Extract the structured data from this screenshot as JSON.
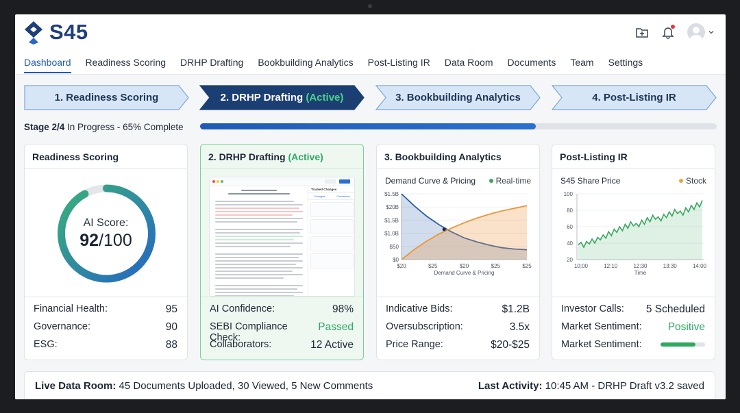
{
  "app": {
    "name": "S45"
  },
  "nav": {
    "items": [
      "Dashboard",
      "Readiness Scoring",
      "DRHP Drafting",
      "Bookbuilding Analytics",
      "Post-Listing IR",
      "Data Room",
      "Documents",
      "Team",
      "Settings"
    ],
    "active": "Dashboard"
  },
  "header_icons": [
    "folder-add-icon",
    "bell-icon",
    "avatar",
    "chevron-down-icon"
  ],
  "stepper": {
    "steps": [
      {
        "label": "1. Readiness Scoring",
        "tag": ""
      },
      {
        "label": "2. DRHP Drafting",
        "tag": "(Active)"
      },
      {
        "label": "3. Bookbuilding Analytics",
        "tag": ""
      },
      {
        "label": "4. Post-Listing IR",
        "tag": ""
      }
    ]
  },
  "progress": {
    "stage": "Stage 2/4",
    "text": "In Progress - 65% Complete",
    "percent": 65
  },
  "cards": {
    "readiness": {
      "title": "Readiness Scoring",
      "score_label": "AI Score:",
      "score_value": "92",
      "score_max": "/100",
      "score": 92,
      "metrics": [
        {
          "label": "Financial Health:",
          "value": "95"
        },
        {
          "label": "Governance:",
          "value": "90"
        },
        {
          "label": "ESG:",
          "value": "88"
        }
      ]
    },
    "drhp": {
      "title": "2. DRHP Drafting",
      "tag": "(Active)",
      "metrics": [
        {
          "label": "AI Confidence:",
          "value": "98%"
        },
        {
          "label": "SEBI Compliance Check:",
          "value": "Passed"
        },
        {
          "label": "Collaborators:",
          "value": "12 Active"
        }
      ],
      "preview": {
        "panel_title": "Tracked Changes",
        "tabs": [
          "Changes",
          "Comments"
        ],
        "buttons": [
          "Preview",
          "Review"
        ]
      }
    },
    "bookbuilding": {
      "title": "3. Bookbuilding Analytics",
      "chart_title": "Demand Curve & Pricing",
      "chart_badge": "Real-time",
      "metrics": [
        {
          "label": "Indicative Bids:",
          "value": "$1.2B"
        },
        {
          "label": "Oversubscription:",
          "value": "3.5x"
        },
        {
          "label": "Price Range:",
          "value": "$20-$25"
        }
      ]
    },
    "postlisting": {
      "title": "Post-Listing IR",
      "chart_title": "S45 Share Price",
      "chart_badge": "Stock",
      "metrics": [
        {
          "label": "Investor Calls:",
          "value": "5 Scheduled"
        },
        {
          "label": "Market Sentiment:",
          "value": "Positive"
        },
        {
          "label": "Market Sentiment:",
          "value": ""
        }
      ],
      "sentiment_level": 0.78
    }
  },
  "chart_data": [
    {
      "type": "line",
      "title": "",
      "xlabel": "Demand Curve & Pricing",
      "ylabel": "",
      "x_ticks": [
        "$20",
        "$25",
        "$20",
        "$25",
        "$25"
      ],
      "y_ticks": [
        "$0",
        "$50",
        "$1.0B",
        "$1.5B",
        "$20B",
        "$1.5B"
      ],
      "series": [
        {
          "name": "",
          "color": "#2d5fa8",
          "x": [
            0,
            0.1,
            0.2,
            0.3,
            0.4,
            0.5,
            0.6,
            0.7,
            0.8,
            0.9,
            1.0
          ],
          "y": [
            1.0,
            0.82,
            0.66,
            0.53,
            0.42,
            0.33,
            0.27,
            0.22,
            0.18,
            0.16,
            0.15
          ]
        },
        {
          "name": "",
          "color": "#e8963c",
          "x": [
            0,
            0.1,
            0.2,
            0.3,
            0.4,
            0.5,
            0.6,
            0.7,
            0.8,
            0.9,
            1.0
          ],
          "y": [
            0.0,
            0.15,
            0.28,
            0.39,
            0.48,
            0.56,
            0.63,
            0.69,
            0.74,
            0.78,
            0.82
          ]
        }
      ],
      "intersection": {
        "x": 0.34,
        "y": 0.46
      }
    },
    {
      "type": "area",
      "title": "",
      "xlabel": "Time",
      "ylabel": "",
      "x_ticks": [
        "10:00",
        "12:10",
        "12:30",
        "13:30",
        "14:00"
      ],
      "y_ticks": [
        20,
        40,
        60,
        80,
        100
      ],
      "ylim": [
        20,
        100
      ],
      "series": [
        {
          "name": "",
          "color": "#3aa65f",
          "values": [
            38,
            41,
            35,
            42,
            39,
            45,
            40,
            47,
            44,
            50,
            46,
            54,
            49,
            57,
            53,
            60,
            55,
            63,
            58,
            66,
            61,
            64,
            60,
            68,
            63,
            71,
            66,
            74,
            69,
            72,
            67,
            75,
            71,
            78,
            73,
            81,
            76,
            79,
            74,
            83,
            78,
            86,
            81,
            89,
            84,
            92
          ]
        }
      ]
    }
  ],
  "footer": {
    "left_label": "Live Data Room:",
    "left_text": "45 Documents Uploaded, 30 Viewed, 5 New Comments",
    "right_label": "Last Activity:",
    "right_text": "10:45 AM - DRHP Draft v3.2 saved"
  }
}
